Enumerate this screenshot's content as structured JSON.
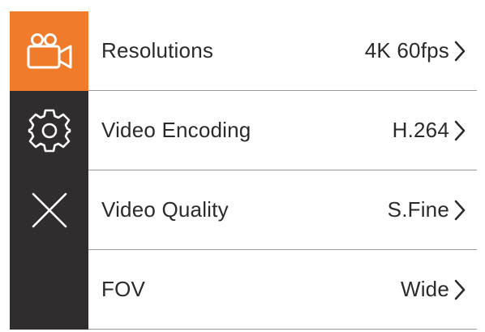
{
  "settings": {
    "items": [
      {
        "icon": "video-camera-icon",
        "label": "Resolutions",
        "value": "4K 60fps",
        "active": true
      },
      {
        "icon": "gear-icon",
        "label": "Video Encoding",
        "value": "H.264",
        "active": false
      },
      {
        "icon": "close-icon",
        "label": "Video Quality",
        "value": "S.Fine",
        "active": false
      },
      {
        "icon": "",
        "label": "FOV",
        "value": "Wide",
        "active": false
      }
    ]
  },
  "colors": {
    "active_icon_bg": "#ef7b2b",
    "icon_bg": "#2f2d2d",
    "text": "#2a2a2a",
    "divider": "#9a9a9a"
  }
}
